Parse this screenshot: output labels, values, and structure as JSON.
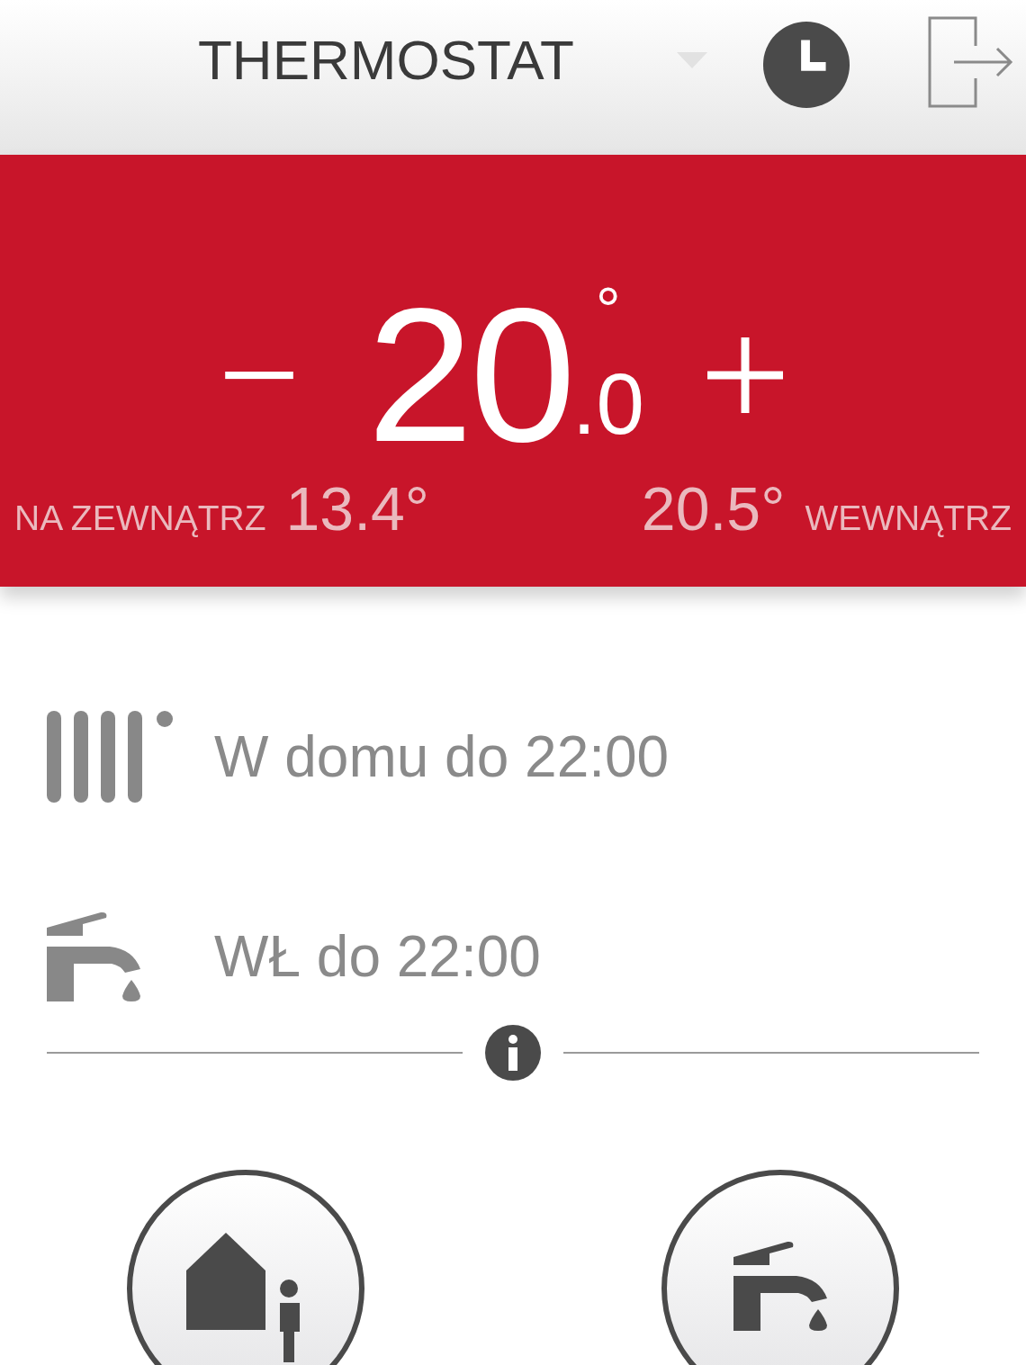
{
  "header": {
    "title": "THERMOSTAT"
  },
  "setpoint": {
    "whole": "20",
    "degree": "°",
    "fraction": ".0"
  },
  "readings": [
    {
      "kind": "outside",
      "label": "NA ZEWNĄTRZ",
      "value": "13.4°"
    },
    {
      "kind": "inside",
      "label": "WEWNĄTRZ",
      "value": "20.5°"
    }
  ],
  "status_rows": [
    {
      "kind": "heating",
      "text": "W domu do 22:00"
    },
    {
      "kind": "water",
      "text": "WŁ do 22:00"
    }
  ],
  "mode_buttons": [
    {
      "kind": "home"
    },
    {
      "kind": "water"
    }
  ]
}
